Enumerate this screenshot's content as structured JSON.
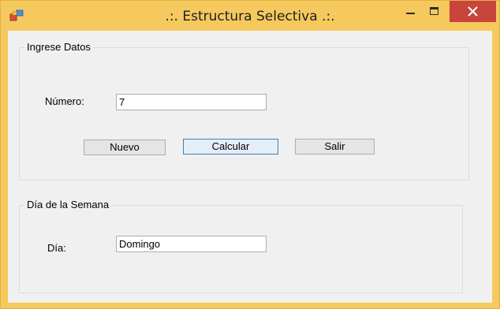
{
  "window": {
    "title": ".:. Estructura Selectiva .:.",
    "icon": "app-window-icon",
    "close_color": "#c7453d"
  },
  "group_input": {
    "legend": "Ingrese Datos",
    "numero_label": "Número:",
    "numero_value": "7"
  },
  "buttons": {
    "nuevo": "Nuevo",
    "calcular": "Calcular",
    "salir": "Salir"
  },
  "group_output": {
    "legend": "Día de la Semana",
    "dia_label": "Día:",
    "dia_value": "Domingo"
  }
}
